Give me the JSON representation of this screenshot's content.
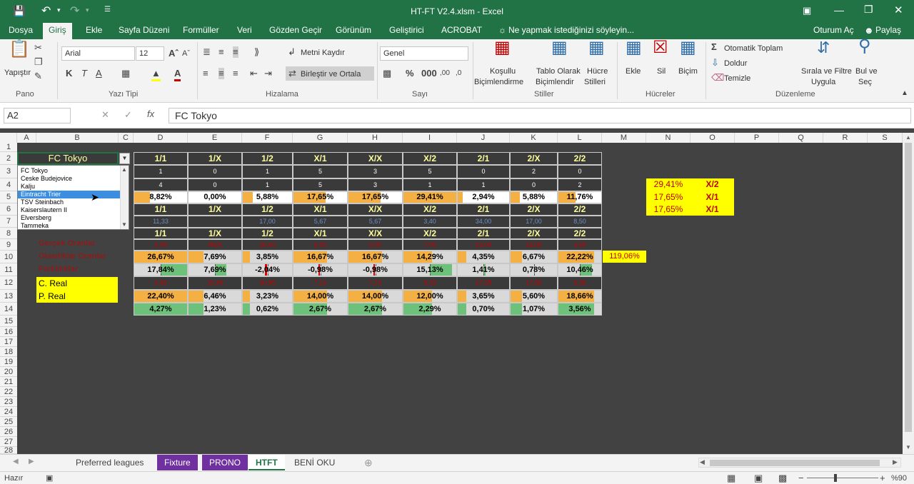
{
  "window": {
    "title": "HT-FT V2.4.xlsm - Excel"
  },
  "tabs": [
    "Dosya",
    "Giriş",
    "Ekle",
    "Sayfa Düzeni",
    "Formüller",
    "Veri",
    "Gözden Geçir",
    "Görünüm",
    "Geliştirici",
    "ACROBAT"
  ],
  "tell_me": "Ne yapmak istediğinizi söyleyin...",
  "signin": "Oturum Aç",
  "share": "Paylaş",
  "ribbon": {
    "paste": "Yapıştır",
    "pano": "Pano",
    "font_name": "Arial",
    "font_size": "12",
    "yazi_tipi": "Yazı Tipi",
    "wrap": "Metni Kaydır",
    "merge": "Birleştir ve Ortala",
    "hizalama": "Hizalama",
    "number_format": "Genel",
    "sayi": "Sayı",
    "cond1": "Koşullu",
    "cond2": "Biçimlendirme",
    "table1": "Tablo Olarak",
    "table2": "Biçimlendir",
    "cell1": "Hücre",
    "cell2": "Stilleri",
    "stiller": "Stiller",
    "insert": "Ekle",
    "delete": "Sil",
    "format": "Biçim",
    "hucreler": "Hücreler",
    "autosum": "Otomatik Toplam",
    "fill": "Doldur",
    "clear": "Temizle",
    "sort1": "Sırala ve Filtre",
    "sort2": "Uygula",
    "find1": "Bul ve",
    "find2": "Seç",
    "duzenleme": "Düzenleme"
  },
  "formula": {
    "namebox": "A2",
    "value": "FC Tokyo"
  },
  "columns": [
    "A",
    "B",
    "C",
    "D",
    "E",
    "F",
    "G",
    "H",
    "I",
    "J",
    "K",
    "L",
    "M",
    "N",
    "O",
    "P",
    "Q",
    "R",
    "S"
  ],
  "rows": [
    "1",
    "2",
    "3",
    "4",
    "5",
    "6",
    "7",
    "8",
    "9",
    "10",
    "11",
    "12",
    "13",
    "14",
    "15",
    "16",
    "17",
    "18",
    "19",
    "20",
    "21",
    "22",
    "23",
    "24",
    "25",
    "26",
    "27",
    "28"
  ],
  "dropdown": {
    "selected": "FC Tokyo",
    "highlighted": "Eintracht Trier",
    "items": [
      "FC Tokyo",
      "Ceske Budejovice",
      "Kalju",
      "Eintracht Trier",
      "TSV Steinbach",
      "Kaiserslautern II",
      "Elversberg",
      "Tammeka"
    ]
  },
  "headers": [
    "1/1",
    "1/X",
    "1/2",
    "X/1",
    "X/X",
    "X/2",
    "2/1",
    "2/X",
    "2/2"
  ],
  "row3": [
    "1",
    "0",
    "1",
    "5",
    "3",
    "5",
    "0",
    "2",
    "0"
  ],
  "row4": [
    "4",
    "0",
    "1",
    "5",
    "3",
    "1",
    "1",
    "0",
    "2"
  ],
  "row5": [
    "8,82%",
    "0,00%",
    "5,88%",
    "17,65%",
    "17,65%",
    "29,41%",
    "2,94%",
    "5,88%",
    "11,76%"
  ],
  "row5_fill": [
    30,
    0,
    20,
    60,
    60,
    100,
    10,
    20,
    40
  ],
  "row7": [
    "11,33",
    "",
    "17,00",
    "5,67",
    "5,67",
    "3,40",
    "34,00",
    "17,00",
    "8,50"
  ],
  "row9": [
    "4,09",
    "#N/A",
    "26,00",
    "6,00",
    "6,00",
    "7,00",
    "23,00",
    "15,00",
    "4,50"
  ],
  "row10": [
    "26,67%",
    "7,69%",
    "3,85%",
    "16,67%",
    "16,67%",
    "14,29%",
    "4,35%",
    "6,67%",
    "22,22%"
  ],
  "row10_fill": [
    100,
    29,
    14,
    63,
    63,
    54,
    16,
    25,
    83
  ],
  "row10_extra": "119,06%",
  "row11": [
    "17,84%",
    "7,69%",
    "-2,04%",
    "-0,98%",
    "-0,98%",
    "15,13%",
    "1,41%",
    "0,78%",
    "10,46%"
  ],
  "row12": [
    "4,46",
    "15,48",
    "30,95",
    "7,14",
    "7,14",
    "8,33",
    "27,38",
    "17,86",
    "5,36"
  ],
  "row13": [
    "22,40%",
    "6,46%",
    "3,23%",
    "14,00%",
    "14,00%",
    "12,00%",
    "3,65%",
    "5,60%",
    "18,66%"
  ],
  "row13_fill": [
    100,
    29,
    14,
    62,
    62,
    54,
    16,
    25,
    83
  ],
  "row14": [
    "4,27%",
    "1,23%",
    "0,62%",
    "2,67%",
    "2,67%",
    "2,29%",
    "0,70%",
    "1,07%",
    "3,56%"
  ],
  "row14_fill": [
    100,
    29,
    14,
    63,
    63,
    54,
    16,
    25,
    83
  ],
  "labels": {
    "r9": "Gerçek Oranlar",
    "r10": "Olasılıklar Oranlar",
    "r11": "Farklılıklar",
    "r12": "C. Real",
    "r13": "P. Real"
  },
  "top3": [
    {
      "pct": "29,41%",
      "res": "X/2"
    },
    {
      "pct": "17,65%",
      "res": "X/1"
    },
    {
      "pct": "17,65%",
      "res": "X/1"
    }
  ],
  "sheets": [
    "Preferred leagues",
    "Fixture",
    "PRONO",
    "HTFT",
    "BENİ OKU"
  ],
  "status": {
    "ready": "Hazır",
    "zoom": "%90"
  },
  "colors": {
    "excel_green": "#217346",
    "orange": "#f4b042",
    "green": "#6ec17b",
    "purple": "#7030a0",
    "yellow": "#ffff00"
  }
}
